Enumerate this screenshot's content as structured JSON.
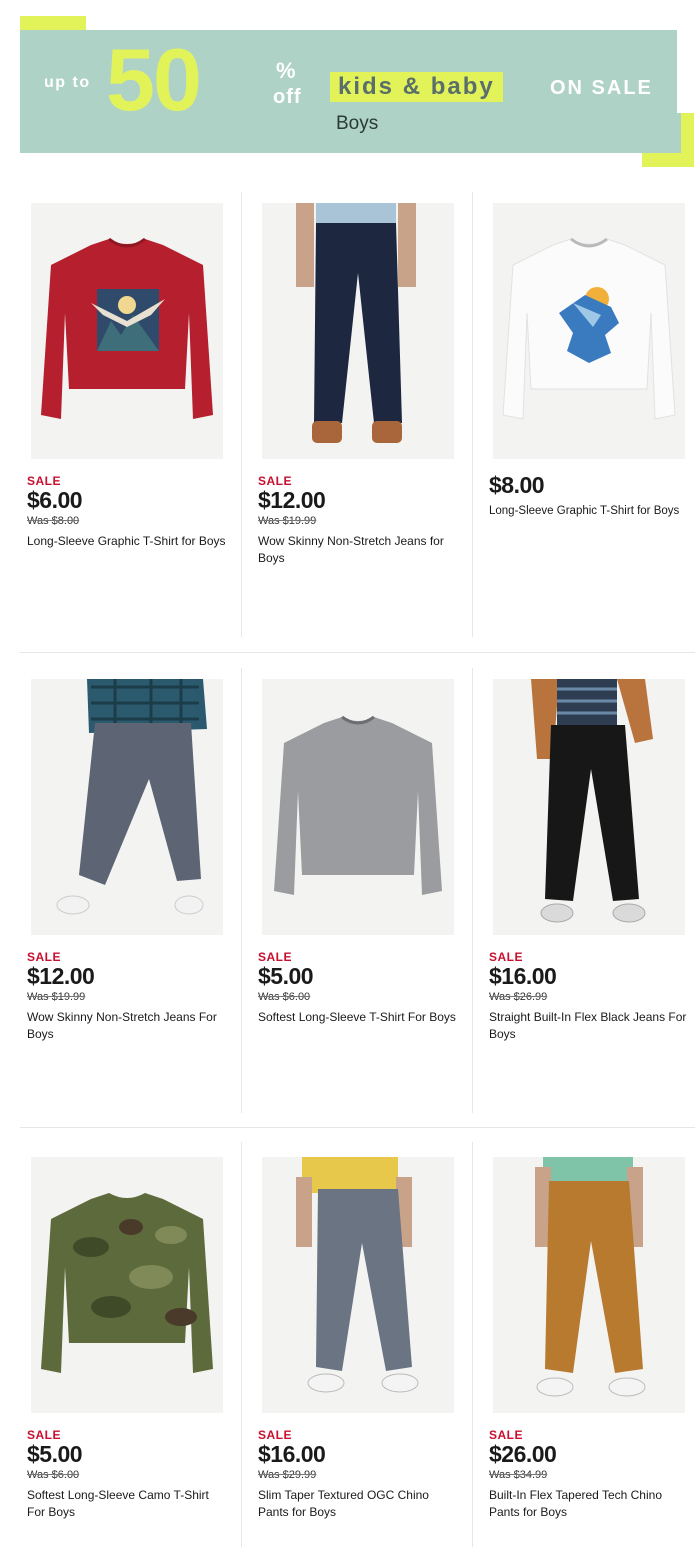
{
  "banner": {
    "up_to": "up to",
    "big_number": "50",
    "percent": "%",
    "off": "off",
    "kids_baby": "kids & baby",
    "on_sale": "ON SALE",
    "subtitle": "Boys",
    "colors": {
      "accent": "#e2f35a",
      "background": "#aed2c6"
    }
  },
  "products": [
    {
      "sale": "SALE",
      "price": "$6.00",
      "was": "Was $8.00",
      "name": "Long-Sleeve Graphic T-Shirt for Boys",
      "image": "red-long-sleeve-eagle-graphic-tee"
    },
    {
      "sale": "SALE",
      "price": "$12.00",
      "was": "Was $19.99",
      "name": "Wow Skinny Non-Stretch Jeans for Boys",
      "image": "dark-wash-jeans"
    },
    {
      "sale": "",
      "price": "$8.00",
      "was": "",
      "name": "Long-Sleeve Graphic T-Shirt for Boys",
      "image": "white-long-sleeve-blue-graphic-tee"
    },
    {
      "sale": "SALE",
      "price": "$12.00",
      "was": "Was $19.99",
      "name": "Wow Skinny Non-Stretch Jeans For Boys",
      "image": "gray-skinny-jeans"
    },
    {
      "sale": "SALE",
      "price": "$5.00",
      "was": "Was $6.00",
      "name": "Softest Long-Sleeve T-Shirt For Boys",
      "image": "gray-long-sleeve-tee"
    },
    {
      "sale": "SALE",
      "price": "$16.00",
      "was": "Was $26.99",
      "name": "Straight Built-In Flex Black Jeans For Boys",
      "image": "black-straight-jeans"
    },
    {
      "sale": "SALE",
      "price": "$5.00",
      "was": "Was $6.00",
      "name": "Softest Long-Sleeve Camo T-Shirt For Boys",
      "image": "camo-long-sleeve-tee"
    },
    {
      "sale": "SALE",
      "price": "$16.00",
      "was": "Was $29.99",
      "name": "Slim Taper Textured OGC Chino Pants for Boys",
      "image": "gray-chino-pants"
    },
    {
      "sale": "SALE",
      "price": "$26.00",
      "was": "Was $34.99",
      "name": "Built-In Flex Tapered Tech Chino Pants for Boys",
      "image": "tan-chino-pants"
    }
  ]
}
